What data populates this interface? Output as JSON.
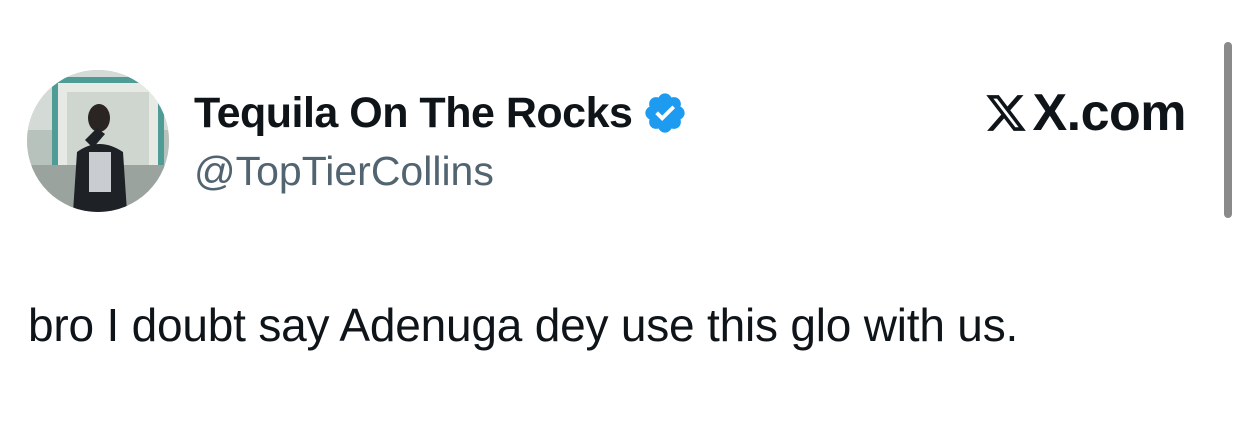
{
  "post": {
    "author": {
      "display_name": "Tequila On The Rocks",
      "handle": "@TopTierCollins",
      "verified": true,
      "avatar_icon": "profile-photo"
    },
    "brand": {
      "text": "X.com",
      "icon": "x-logo-icon"
    },
    "text": "bro I doubt say Adenuga dey use this glo with us."
  },
  "colors": {
    "text_primary": "#0f1419",
    "text_secondary": "#536471",
    "verified_badge": "#1d9bf0",
    "background": "#ffffff"
  }
}
